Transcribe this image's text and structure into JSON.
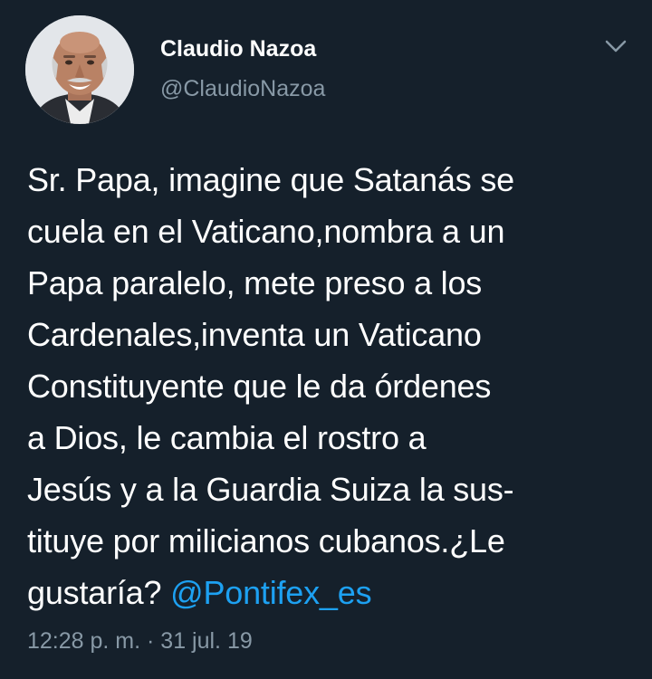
{
  "tweet": {
    "author_name": "Claudio Nazoa",
    "author_handle": "@ClaudioNazoa",
    "lines": [
      "Sr. Papa, imagine que Satanás se",
      "cuela en el Vaticano,nombra a un",
      "Papa paralelo, mete preso a los",
      "Cardenales,inventa un Vaticano",
      "Constituyente que le da órdenes",
      "a Dios, le cambia el rostro a",
      "Jesús y a la Guardia Suiza la sus-",
      "tituye por milicianos cubanos.¿Le"
    ],
    "last_line_text": "gustaría? ",
    "mention": "@Pontifex_es",
    "timestamp": "12:28 p. m. · 31 jul. 19"
  },
  "icons": {
    "menu": "chevron-down-icon",
    "avatar": "profile-photo"
  },
  "colors": {
    "background": "#15202b",
    "primary_text": "#ffffff",
    "secondary_text": "#8899a6",
    "link": "#1da1f2"
  }
}
